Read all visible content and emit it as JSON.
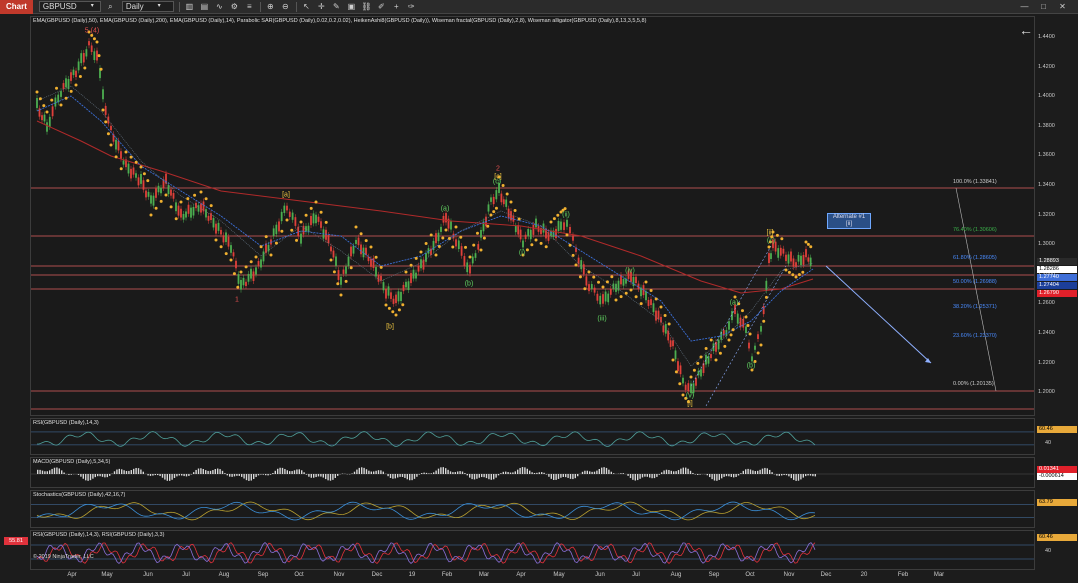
{
  "toolbar": {
    "title": "Chart",
    "instrument": "GBPUSD",
    "interval": "Daily"
  },
  "main_panel": {
    "indicators_label": "EMA(GBPUSD (Daily),50), EMA(GBPUSD (Daily),200), EMA(GBPUSD (Daily),14), Parabolic SAR(GBPUSD (Daily),0.02,0.2,0.02), HeikenAshi8(GBPUSD (Daily)), Wiseman fractal(GBPUSD (Daily),2,8), Wiseman alligator(GBPUSD (Daily),8,13,3,5,5,8)",
    "price_ticks": [
      "1.4400",
      "1.4200",
      "1.4000",
      "1.3800",
      "1.3600",
      "1.3400",
      "1.3200",
      "1.3000",
      "1.2800",
      "1.2600",
      "1.2400",
      "1.2200",
      "1.2000"
    ],
    "price_tags": [
      {
        "text": "1.28893",
        "color": "#2a2a2a",
        "fg": "#ffffff"
      },
      {
        "text": "1.28286",
        "color": "#ffffff",
        "fg": "#000000"
      },
      {
        "text": "1.27740",
        "color": "#3f6fd8",
        "fg": "#ffffff"
      },
      {
        "text": "1.27404",
        "color": "#1c3f9a",
        "fg": "#ffffff"
      },
      {
        "text": "1.26790",
        "color": "#e0202a",
        "fg": "#ffffff"
      }
    ],
    "fib_levels": [
      {
        "label": "100.0% (1.33841)",
        "color": "#cfcfcf"
      },
      {
        "label": "76.40% (1.30606)",
        "color": "#3bb04a"
      },
      {
        "label": "61.80% (1.28605)",
        "color": "#4a8cff"
      },
      {
        "label": "50.00% (1.26988)",
        "color": "#4a8cff"
      },
      {
        "label": "38.20% (1.25371)",
        "color": "#4a8cff"
      },
      {
        "label": "23.60% (1.23370)",
        "color": "#4a8cff"
      },
      {
        "label": "0.00% (1.20135)",
        "color": "#cfcfcf"
      }
    ],
    "alternate_box": {
      "line1": "Alternate #1",
      "line2": "[ii]"
    },
    "wave_labels": [
      {
        "text": "5 (4)",
        "color": "#e05050"
      },
      {
        "text": "1",
        "color": "#e05050"
      },
      {
        "text": "[a]",
        "color": "#e8c040"
      },
      {
        "text": "[b]",
        "color": "#e8c040"
      },
      {
        "text": "2",
        "color": "#e05050"
      },
      {
        "text": "[c]",
        "color": "#e8c040"
      },
      {
        "text": "(a)",
        "color": "#60d060"
      },
      {
        "text": "(b)",
        "color": "#60d060"
      },
      {
        "text": "(c)",
        "color": "#60d060"
      },
      {
        "text": "(i)",
        "color": "#60d060"
      },
      {
        "text": "(ii)",
        "color": "#60d060"
      },
      {
        "text": "(iii)",
        "color": "#60d060"
      },
      {
        "text": "(iv)",
        "color": "#60d060"
      },
      {
        "text": "(v)",
        "color": "#60d060"
      },
      {
        "text": "[i]",
        "color": "#e8c040"
      },
      {
        "text": "(a)",
        "color": "#60d060"
      },
      {
        "text": "(b)",
        "color": "#60d060"
      },
      {
        "text": "[ii]",
        "color": "#e8c040"
      },
      {
        "text": "(c)",
        "color": "#60d060"
      }
    ]
  },
  "rsi_panel": {
    "label": "RSI(GBPUSD (Daily),14,3)",
    "ticks": [
      "40"
    ],
    "tag": "60.46"
  },
  "macd_panel": {
    "label": "MACD(GBPUSD (Daily),5,34,5)",
    "tag1": "0.01341",
    "tag2": "-0.000614"
  },
  "stoch_panel": {
    "label": "Stochastics(GBPUSD (Daily),42,16,7)",
    "tag": "63.79"
  },
  "rsi2_panel": {
    "label": "RSI(GBPUSD (Daily),14,3), RSI(GBPUSD (Daily),3,3)",
    "ticks": [
      "40"
    ],
    "tag": "60.46",
    "left_tag": "55.81",
    "copyright": "© 2019 NinjaTrader, LLC"
  },
  "time_axis": [
    "Apr",
    "May",
    "Jun",
    "Jul",
    "Aug",
    "Sep",
    "Oct",
    "Nov",
    "Dec",
    "19",
    "Feb",
    "Mar",
    "Apr",
    "May",
    "Jun",
    "Jul",
    "Aug",
    "Sep",
    "Oct",
    "Nov",
    "Dec",
    "20",
    "Feb",
    "Mar"
  ]
}
